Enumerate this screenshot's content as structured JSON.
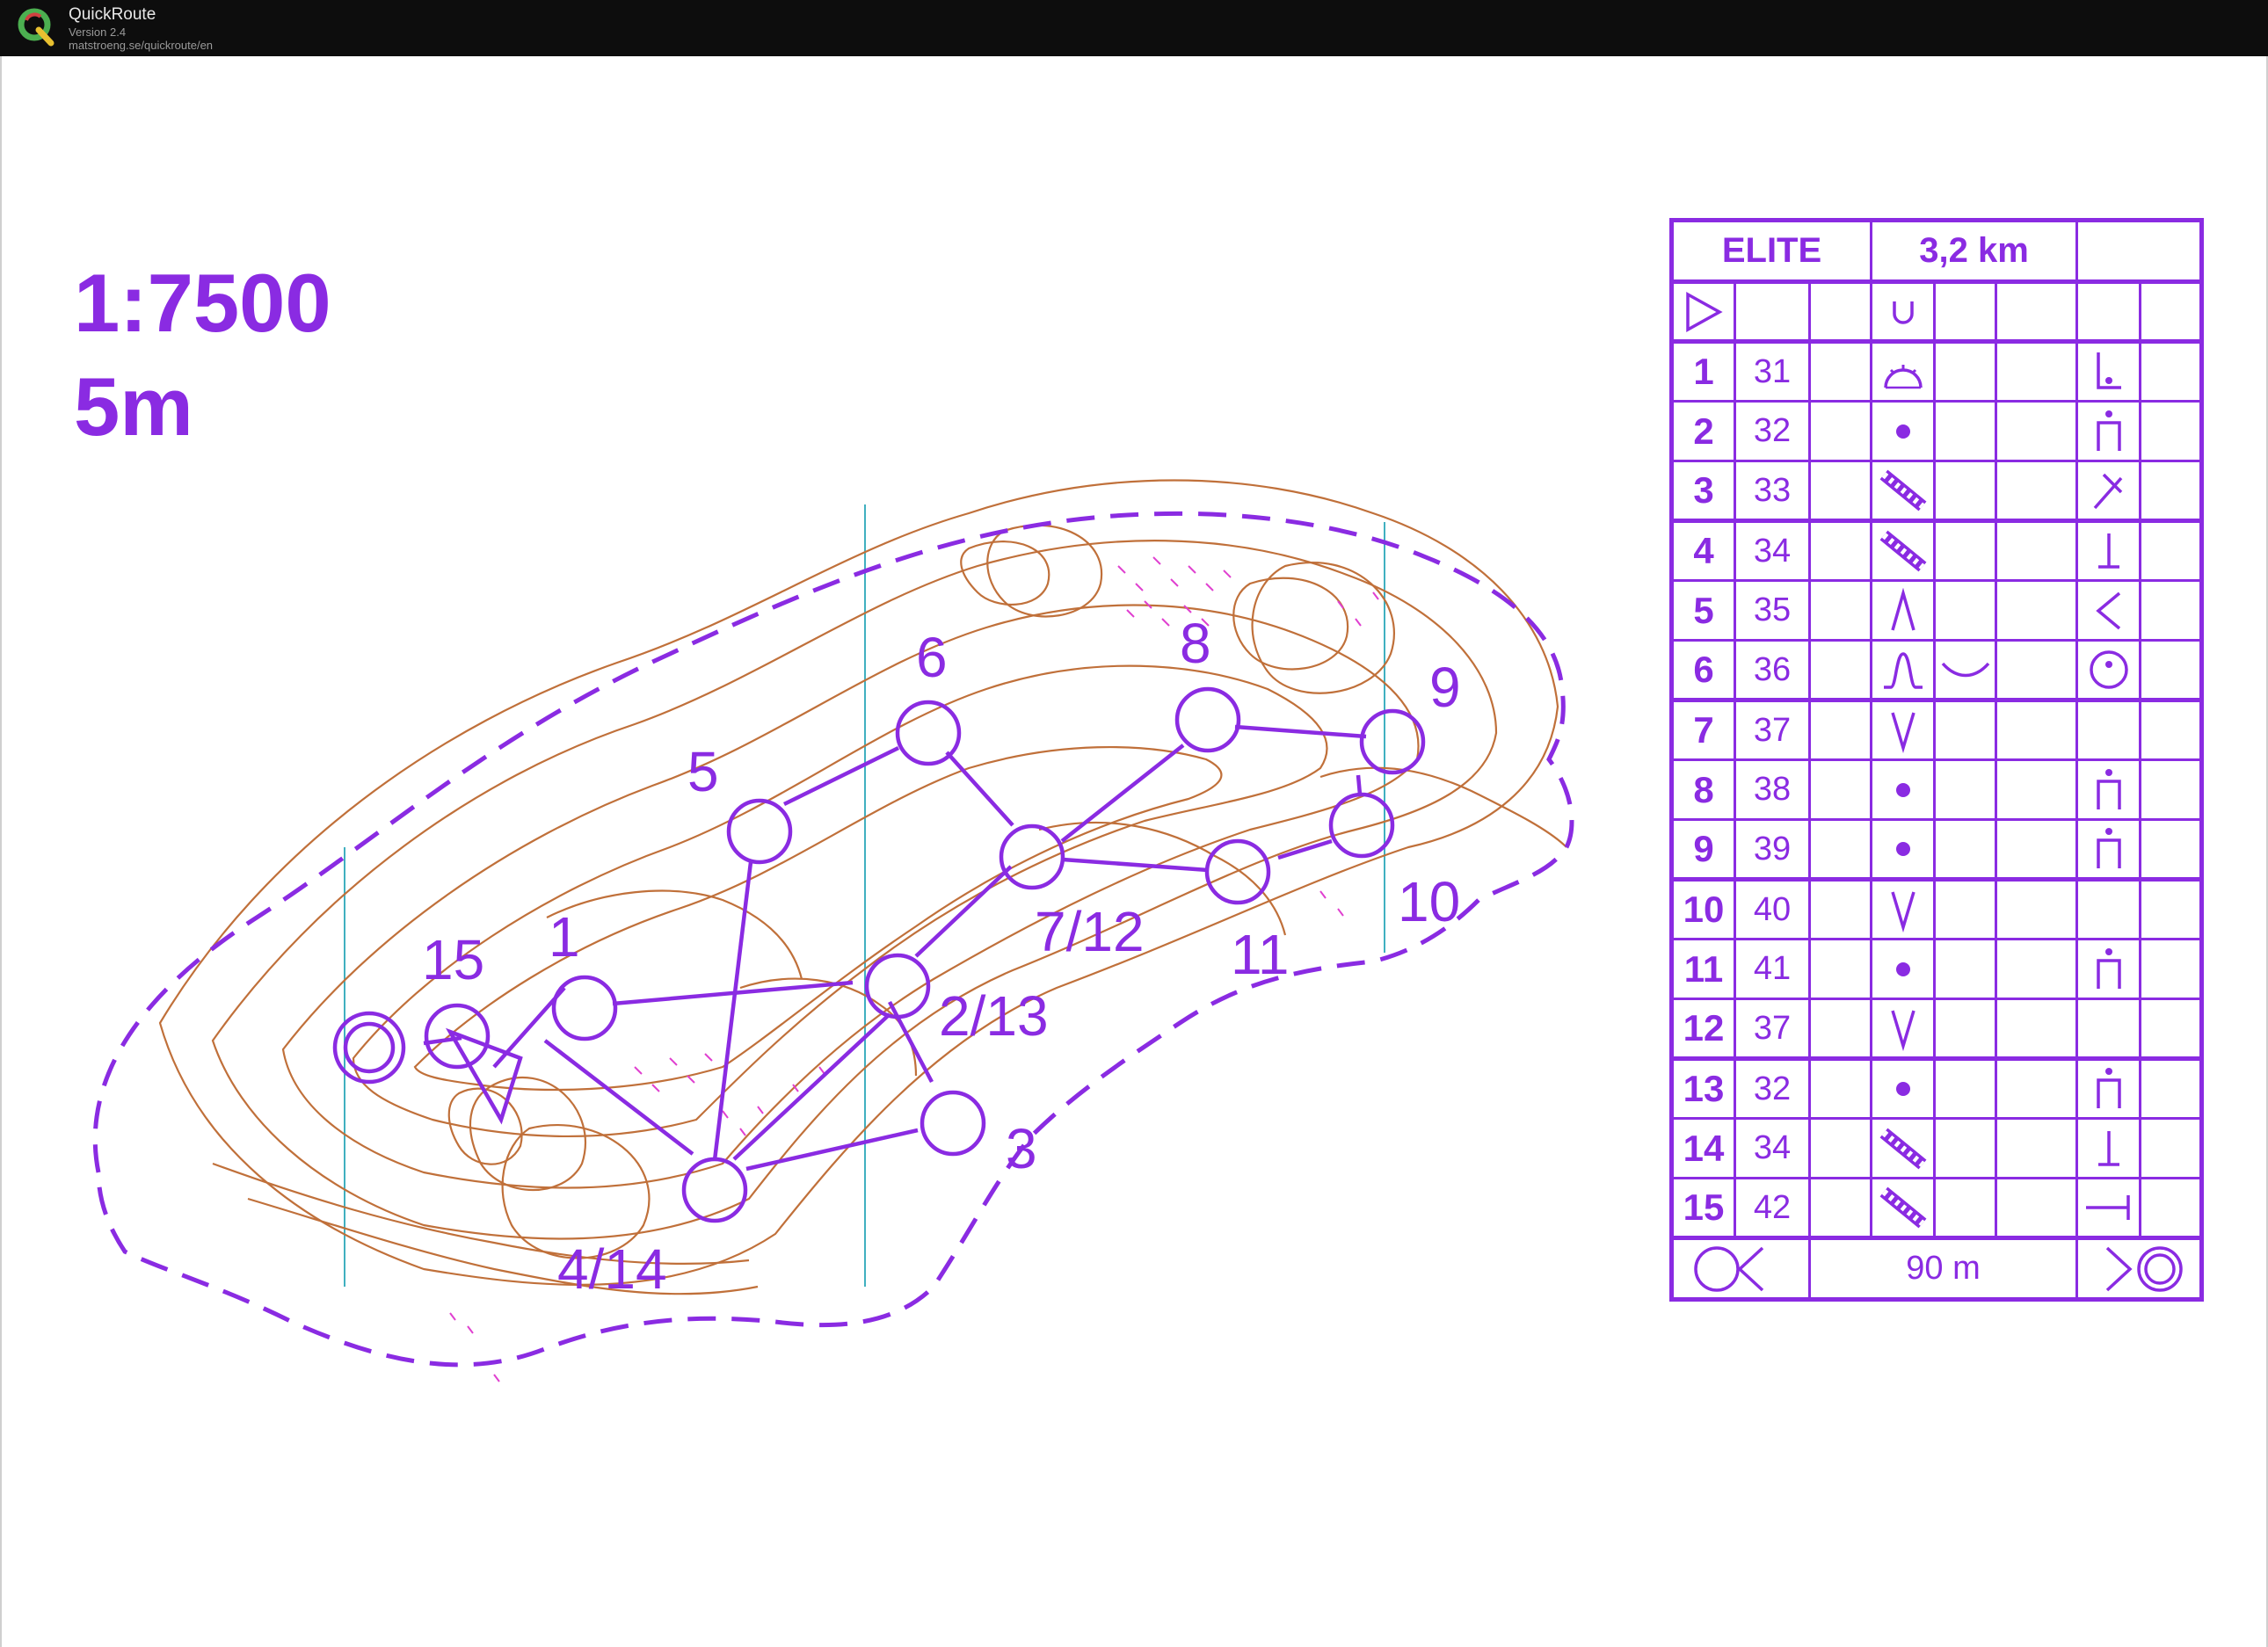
{
  "window": {
    "app_name": "QuickRoute",
    "version": "Version 2.4",
    "url": "matstroeng.se/quickroute/en"
  },
  "map": {
    "scale": "1:7500",
    "contour_interval": "5m",
    "colors": {
      "course": "#8a2be2",
      "contours": "#c0703a",
      "rocky": "#e040d0",
      "meridians": "#40b0c0"
    },
    "controls": [
      {
        "label": "1"
      },
      {
        "label": "2/13"
      },
      {
        "label": "3"
      },
      {
        "label": "4/14"
      },
      {
        "label": "5"
      },
      {
        "label": "6"
      },
      {
        "label": "7/12"
      },
      {
        "label": "8"
      },
      {
        "label": "9"
      },
      {
        "label": "10"
      },
      {
        "label": "11"
      },
      {
        "label": "15"
      }
    ]
  },
  "description_sheet": {
    "class": "ELITE",
    "length": "3,2 km",
    "start_symbol": "start-triangle",
    "rows": [
      {
        "num": "1",
        "code": "31",
        "feature": "rootstock",
        "detail": "foot-corner"
      },
      {
        "num": "2",
        "code": "32",
        "feature": "boulder",
        "detail": "north-side"
      },
      {
        "num": "3",
        "code": "33",
        "feature": "boulder-field",
        "detail": "north-west-corner"
      },
      {
        "num": "4",
        "code": "34",
        "feature": "boulder-field",
        "detail": "foot"
      },
      {
        "num": "5",
        "code": "35",
        "feature": "spur",
        "detail": "west-part"
      },
      {
        "num": "6",
        "code": "36",
        "feature": "knoll",
        "feature2": "shallow",
        "detail": "top"
      },
      {
        "num": "7",
        "code": "37",
        "feature": "re-entrant",
        "detail": ""
      },
      {
        "num": "8",
        "code": "38",
        "feature": "boulder",
        "detail": "north-side"
      },
      {
        "num": "9",
        "code": "39",
        "feature": "boulder",
        "detail": "north-side"
      },
      {
        "num": "10",
        "code": "40",
        "feature": "re-entrant",
        "detail": ""
      },
      {
        "num": "11",
        "code": "41",
        "feature": "boulder",
        "detail": "north-side"
      },
      {
        "num": "12",
        "code": "37",
        "feature": "re-entrant",
        "detail": ""
      },
      {
        "num": "13",
        "code": "32",
        "feature": "boulder",
        "detail": "north-side"
      },
      {
        "num": "14",
        "code": "34",
        "feature": "boulder-field",
        "detail": "foot"
      },
      {
        "num": "15",
        "code": "42",
        "feature": "boulder-field",
        "detail": "east-side"
      }
    ],
    "finish": {
      "distance": "90 m"
    }
  }
}
